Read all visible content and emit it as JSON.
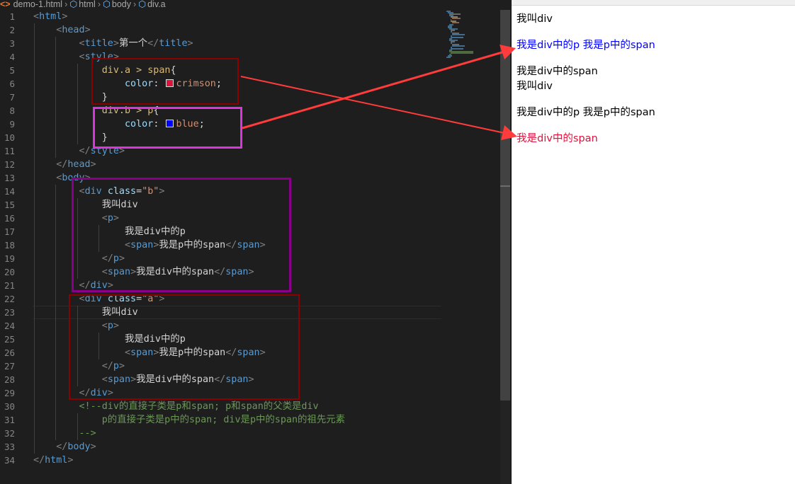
{
  "breadcrumb": {
    "file": "demo-1.html",
    "items": [
      "html",
      "body",
      "div.a"
    ]
  },
  "line_numbers": [
    "1",
    "2",
    "3",
    "4",
    "5",
    "6",
    "7",
    "8",
    "9",
    "10",
    "11",
    "12",
    "13",
    "14",
    "15",
    "16",
    "17",
    "18",
    "19",
    "20",
    "21",
    "22",
    "23",
    "24",
    "25",
    "26",
    "27",
    "28",
    "29",
    "30",
    "31",
    "32",
    "33",
    "34"
  ],
  "code": {
    "l1_html": "html",
    "l2_head": "head",
    "l3_title": "title",
    "l3_text": "第一个",
    "l4_style": "style",
    "l5_sel": "div.a > span",
    "l6_prop": "color",
    "l6_val": "crimson",
    "l8_sel": "div.b > p",
    "l9_prop": "color",
    "l9_val": "blue",
    "l11_style": "style",
    "l12_head": "head",
    "l13_body": "body",
    "div": "div",
    "class_attr": "class",
    "class_b": "\"b\"",
    "class_a": "\"a\"",
    "p": "p",
    "span": "span",
    "text_wojiao": "我叫div",
    "text_p": "我是div中的p",
    "text_span_in_p": "我是p中的span",
    "text_span_in_div": "我是div中的span",
    "comment1": "<!--div的直接子类是p和span; p和span的父类是div",
    "comment2": "p的直接子类是p中的span; div是p中的span的祖先元素",
    "comment3": "-->",
    "l33_body": "body",
    "l34_html": "html"
  },
  "colors": {
    "crimson": "#dc143c",
    "blue": "#0000ff",
    "box_dark_red": "#8b0000",
    "box_magenta": "#e033e0",
    "box_purple": "#8b008b",
    "arrow_red": "#ff3b3b"
  },
  "browser": {
    "lines": [
      {
        "text": "我叫div",
        "color": "black"
      },
      {
        "text": "我是div中的p 我是p中的span",
        "color": "blue"
      },
      {
        "text": "我是div中的span",
        "color": "black"
      },
      {
        "text": "我叫div",
        "color": "black"
      },
      {
        "text": "我是div中的p 我是p中的span",
        "color": "black"
      },
      {
        "text": "我是div中的span",
        "color": "crimson"
      }
    ]
  }
}
